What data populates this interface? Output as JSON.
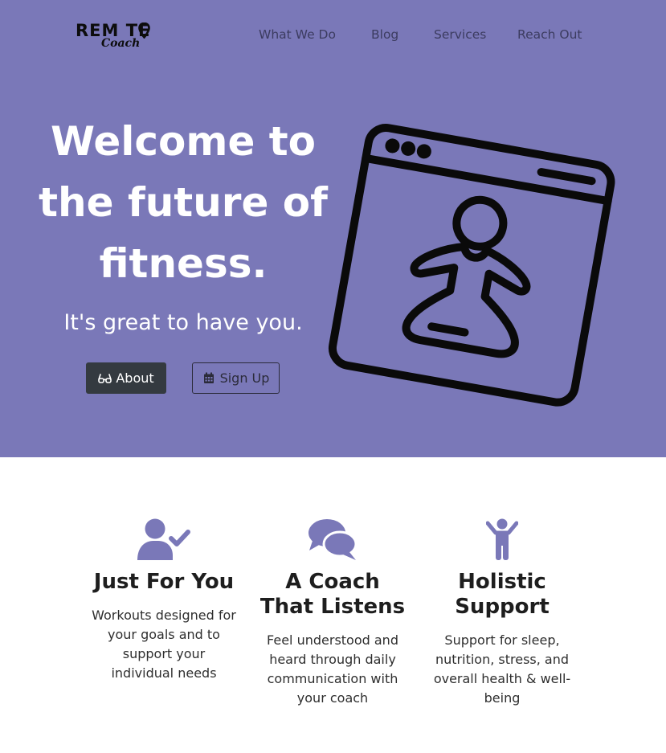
{
  "header": {
    "logo_main": "REM TE",
    "logo_sub": "Coach",
    "nav": [
      "What We Do",
      "Blog",
      "Services",
      "Reach Out"
    ]
  },
  "hero": {
    "headline": "Welcome to the future of fitness.",
    "subhead": "It's great to have you.",
    "about_label": "About",
    "signup_label": "Sign Up",
    "about_icon": "glasses-icon",
    "signup_icon": "calendar-icon",
    "illustration": "browser-window-meditating-person-icon"
  },
  "features": [
    {
      "icon": "user-check-icon",
      "title": "Just For You",
      "text": "Workouts designed for your goals and to support your individual needs"
    },
    {
      "icon": "comments-icon",
      "title": "A Coach That Listens",
      "text": "Feel understood and heard through daily communication with your coach"
    },
    {
      "icon": "child-icon",
      "title": "Holistic Support",
      "text": "Support for sleep, nutrition, stress, and overall health & well-being"
    }
  ],
  "colors": {
    "hero_bg": "#7a78b8",
    "accent_icon": "#7a78b8",
    "dark_button": "#343a40"
  }
}
